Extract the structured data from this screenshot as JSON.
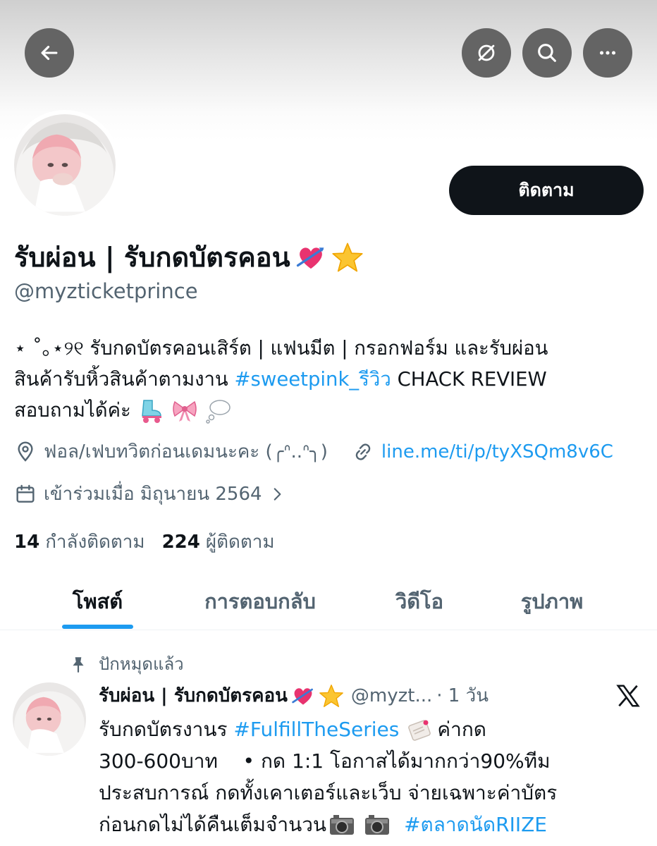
{
  "topbar": {
    "back_icon": "arrow-left-icon",
    "grok_icon": "grok-slash-circle-icon",
    "search_icon": "search-icon",
    "more_icon": "more-horizontal-icon"
  },
  "profile": {
    "follow_label": "ติดตาม",
    "display_name": "รับผ่อน | รับกดบัตรคอน",
    "handle": "@myzticketprince",
    "bio": {
      "line1": "⋆ ˚｡⋆୨୧ รับกดบัตรคอนเสิร์ต | แฟนมีต | กรอกฟอร์ม และรับผ่อน",
      "line2_prefix": "สินค้ารับหิ้วสินค้าตามงาน ",
      "line2_hashtag": "#sweetpink_รีวิว",
      "line2_suffix": " CHACK REVIEW",
      "line3": "สอบถามได้ค่ะ"
    },
    "location": "ฟอล/เฟบทวิตก่อนเดมนะคะ (╭ᐢ..ᐢ╮)",
    "website": "line.me/ti/p/tyXSQm8v6C",
    "joined": "เข้าร่วมเมื่อ มิถุนายน 2564",
    "following_count": "14",
    "following_label": "กำลังติดตาม",
    "followers_count": "224",
    "followers_label": "ผู้ติดตาม"
  },
  "tabs": [
    {
      "label": "โพสต์"
    },
    {
      "label": "การตอบกลับ"
    },
    {
      "label": "วิดีโอ"
    },
    {
      "label": "รูปภาพ"
    }
  ],
  "post": {
    "pinned_label": "ปักหมุดแล้ว",
    "author_name": "รับผ่อน | รับกดบัตรคอน",
    "author_handle": "@myzt...",
    "time": "· 1 วัน",
    "line1_prefix": "รับกดบัตรงานร ",
    "line1_hashtag": "#FulfillTheSeries",
    "line1_suffix": "ค่ากด",
    "line2": "300-600บาท    • กด 1:1 โอกาสได้มากกว่า90%ทีม",
    "line3": "ประสบการณ์ กดทั้งเคาเตอร์และเว็บ จ่ายเฉพาะค่าบัตร",
    "line4_prefix": "ก่อนกดไม่ได้คืนเต็มจำนวน",
    "line4_hashtag": "#ตลาดนัดRIIZE"
  }
}
